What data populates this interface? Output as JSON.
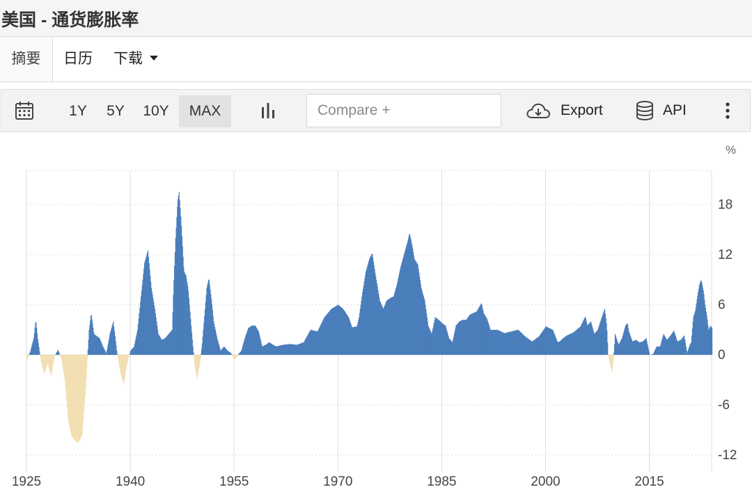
{
  "title": "美国 - 通货膨胀率",
  "tabs": {
    "summary": "摘要",
    "calendar": "日历",
    "download": "下载"
  },
  "toolbar": {
    "ranges": [
      "1Y",
      "5Y",
      "10Y",
      "MAX"
    ],
    "selected_range": "MAX",
    "compare_placeholder": "Compare +",
    "export_label": "Export",
    "api_label": "API"
  },
  "icons": [
    "calendar-icon",
    "bar-chart-icon",
    "cloud-download-icon",
    "database-icon",
    "more-vertical-icon"
  ],
  "colors": {
    "positive": "#4a7ebb",
    "negative": "#f2dfb2",
    "grid": "#dddddd",
    "text": "#444444"
  },
  "chart_data": {
    "type": "bar",
    "unit": "%",
    "x_ticks": [
      "1925",
      "1940",
      "1955",
      "1970",
      "1985",
      "2000",
      "2015"
    ],
    "y_ticks": [
      "18",
      "12",
      "6",
      "0",
      "-6",
      "-12"
    ],
    "y_range": [
      -14,
      22
    ],
    "x_range": [
      1925,
      2024
    ],
    "grid": true,
    "series_keypoints": [
      [
        1925.0,
        -0.6
      ],
      [
        1925.5,
        0.4
      ],
      [
        1926.0,
        2.0
      ],
      [
        1926.3,
        4.2
      ],
      [
        1926.6,
        1.8
      ],
      [
        1927.0,
        -0.5
      ],
      [
        1927.5,
        -2.3
      ],
      [
        1928.0,
        -1.0
      ],
      [
        1928.5,
        -2.5
      ],
      [
        1929.0,
        -0.2
      ],
      [
        1929.5,
        0.6
      ],
      [
        1930.0,
        -0.5
      ],
      [
        1930.5,
        -3.0
      ],
      [
        1931.0,
        -8.0
      ],
      [
        1931.5,
        -9.8
      ],
      [
        1932.0,
        -10.3
      ],
      [
        1932.5,
        -10.5
      ],
      [
        1933.0,
        -9.5
      ],
      [
        1933.5,
        -4.0
      ],
      [
        1934.0,
        3.0
      ],
      [
        1934.3,
        5.0
      ],
      [
        1934.7,
        2.5
      ],
      [
        1935.5,
        2.0
      ],
      [
        1936.0,
        1.0
      ],
      [
        1936.5,
        0.2
      ],
      [
        1937.0,
        2.5
      ],
      [
        1937.5,
        4.0
      ],
      [
        1938.0,
        0.5
      ],
      [
        1938.5,
        -2.0
      ],
      [
        1939.0,
        -3.5
      ],
      [
        1939.5,
        -1.0
      ],
      [
        1940.0,
        0.5
      ],
      [
        1940.5,
        1.0
      ],
      [
        1941.0,
        3.0
      ],
      [
        1941.5,
        7.0
      ],
      [
        1942.0,
        11.0
      ],
      [
        1942.5,
        12.5
      ],
      [
        1943.0,
        8.0
      ],
      [
        1943.5,
        5.5
      ],
      [
        1944.0,
        2.5
      ],
      [
        1944.5,
        1.8
      ],
      [
        1945.0,
        2.0
      ],
      [
        1945.5,
        2.5
      ],
      [
        1946.0,
        3.0
      ],
      [
        1946.2,
        8.0
      ],
      [
        1946.5,
        14.0
      ],
      [
        1946.8,
        18.5
      ],
      [
        1947.0,
        19.5
      ],
      [
        1947.3,
        16.0
      ],
      [
        1947.7,
        10.0
      ],
      [
        1948.0,
        9.5
      ],
      [
        1948.3,
        8.0
      ],
      [
        1948.7,
        4.0
      ],
      [
        1949.0,
        1.0
      ],
      [
        1949.3,
        -1.5
      ],
      [
        1949.6,
        -2.9
      ],
      [
        1950.0,
        -1.0
      ],
      [
        1950.3,
        1.0
      ],
      [
        1950.6,
        4.0
      ],
      [
        1951.0,
        8.0
      ],
      [
        1951.3,
        9.2
      ],
      [
        1951.7,
        6.5
      ],
      [
        1952.0,
        4.0
      ],
      [
        1952.5,
        2.0
      ],
      [
        1953.0,
        0.5
      ],
      [
        1953.5,
        1.0
      ],
      [
        1954.0,
        0.5
      ],
      [
        1954.5,
        0.2
      ],
      [
        1955.0,
        -0.6
      ],
      [
        1955.5,
        0.0
      ],
      [
        1956.0,
        0.5
      ],
      [
        1956.5,
        2.0
      ],
      [
        1957.0,
        3.2
      ],
      [
        1957.5,
        3.5
      ],
      [
        1958.0,
        3.5
      ],
      [
        1958.5,
        2.8
      ],
      [
        1959.0,
        1.0
      ],
      [
        1959.5,
        1.2
      ],
      [
        1960.0,
        1.5
      ],
      [
        1961.0,
        1.0
      ],
      [
        1962.0,
        1.2
      ],
      [
        1963.0,
        1.3
      ],
      [
        1964.0,
        1.2
      ],
      [
        1965.0,
        1.5
      ],
      [
        1966.0,
        3.0
      ],
      [
        1967.0,
        2.8
      ],
      [
        1968.0,
        4.5
      ],
      [
        1969.0,
        5.5
      ],
      [
        1970.0,
        6.0
      ],
      [
        1970.7,
        5.5
      ],
      [
        1971.5,
        4.5
      ],
      [
        1972.0,
        3.3
      ],
      [
        1972.7,
        3.4
      ],
      [
        1973.0,
        4.5
      ],
      [
        1973.5,
        7.5
      ],
      [
        1974.0,
        10.0
      ],
      [
        1974.5,
        11.5
      ],
      [
        1974.9,
        12.2
      ],
      [
        1975.3,
        10.0
      ],
      [
        1975.7,
        8.0
      ],
      [
        1976.0,
        6.5
      ],
      [
        1976.5,
        5.5
      ],
      [
        1977.0,
        6.5
      ],
      [
        1977.5,
        6.8
      ],
      [
        1978.0,
        7.0
      ],
      [
        1978.5,
        8.5
      ],
      [
        1979.0,
        10.5
      ],
      [
        1979.5,
        12.0
      ],
      [
        1980.0,
        13.5
      ],
      [
        1980.3,
        14.6
      ],
      [
        1980.7,
        13.0
      ],
      [
        1981.0,
        11.5
      ],
      [
        1981.5,
        10.8
      ],
      [
        1982.0,
        8.0
      ],
      [
        1982.5,
        6.5
      ],
      [
        1983.0,
        3.5
      ],
      [
        1983.5,
        2.5
      ],
      [
        1984.0,
        4.5
      ],
      [
        1984.5,
        4.2
      ],
      [
        1985.0,
        3.8
      ],
      [
        1985.5,
        3.5
      ],
      [
        1986.0,
        2.0
      ],
      [
        1986.5,
        1.5
      ],
      [
        1987.0,
        3.5
      ],
      [
        1987.5,
        4.0
      ],
      [
        1988.0,
        4.2
      ],
      [
        1988.5,
        4.2
      ],
      [
        1989.0,
        4.8
      ],
      [
        1989.5,
        5.0
      ],
      [
        1990.0,
        5.2
      ],
      [
        1990.7,
        6.2
      ],
      [
        1991.0,
        5.0
      ],
      [
        1991.5,
        4.3
      ],
      [
        1992.0,
        3.0
      ],
      [
        1993.0,
        3.0
      ],
      [
        1994.0,
        2.6
      ],
      [
        1995.0,
        2.8
      ],
      [
        1996.0,
        3.0
      ],
      [
        1997.0,
        2.2
      ],
      [
        1998.0,
        1.6
      ],
      [
        1999.0,
        2.2
      ],
      [
        2000.0,
        3.4
      ],
      [
        2001.0,
        3.0
      ],
      [
        2001.7,
        1.5
      ],
      [
        2002.0,
        1.6
      ],
      [
        2002.5,
        2.0
      ],
      [
        2003.0,
        2.3
      ],
      [
        2004.0,
        2.7
      ],
      [
        2005.0,
        3.4
      ],
      [
        2005.7,
        4.6
      ],
      [
        2006.0,
        3.5
      ],
      [
        2006.5,
        4.0
      ],
      [
        2007.0,
        2.5
      ],
      [
        2007.5,
        3.0
      ],
      [
        2008.0,
        4.3
      ],
      [
        2008.5,
        5.5
      ],
      [
        2008.8,
        3.5
      ],
      [
        2009.0,
        0.0
      ],
      [
        2009.4,
        -1.5
      ],
      [
        2009.6,
        -2.1
      ],
      [
        2009.9,
        1.0
      ],
      [
        2010.0,
        2.5
      ],
      [
        2010.5,
        1.2
      ],
      [
        2011.0,
        2.0
      ],
      [
        2011.5,
        3.5
      ],
      [
        2011.8,
        3.8
      ],
      [
        2012.0,
        2.8
      ],
      [
        2012.5,
        1.6
      ],
      [
        2013.0,
        1.8
      ],
      [
        2013.5,
        1.5
      ],
      [
        2014.0,
        1.6
      ],
      [
        2014.5,
        2.0
      ],
      [
        2015.0,
        0.0
      ],
      [
        2015.5,
        0.1
      ],
      [
        2016.0,
        1.0
      ],
      [
        2016.5,
        1.0
      ],
      [
        2017.0,
        2.5
      ],
      [
        2017.5,
        1.8
      ],
      [
        2018.0,
        2.3
      ],
      [
        2018.5,
        2.9
      ],
      [
        2019.0,
        1.6
      ],
      [
        2019.5,
        1.8
      ],
      [
        2020.0,
        2.3
      ],
      [
        2020.4,
        0.2
      ],
      [
        2020.8,
        1.2
      ],
      [
        2021.0,
        1.5
      ],
      [
        2021.3,
        4.5
      ],
      [
        2021.6,
        5.3
      ],
      [
        2021.9,
        7.0
      ],
      [
        2022.2,
        8.5
      ],
      [
        2022.45,
        9.0
      ],
      [
        2022.8,
        7.5
      ],
      [
        2023.0,
        6.0
      ],
      [
        2023.3,
        4.5
      ],
      [
        2023.5,
        3.0
      ],
      [
        2023.8,
        3.5
      ],
      [
        2024.0,
        3.2
      ]
    ]
  }
}
